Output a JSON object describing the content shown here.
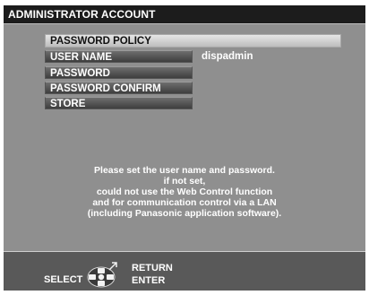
{
  "window": {
    "title": "ADMINISTRATOR ACCOUNT"
  },
  "menu": {
    "items": [
      {
        "label": "PASSWORD POLICY",
        "selected": true
      },
      {
        "label": "USER NAME",
        "value": "dispadmin"
      },
      {
        "label": "PASSWORD"
      },
      {
        "label": "PASSWORD CONFIRM"
      },
      {
        "label": "STORE"
      }
    ]
  },
  "message": {
    "lines": [
      "Please set the user name and password.",
      "if not set,",
      "could not use the Web Control function",
      "and for communication control via a LAN",
      "(including Panasonic application software)."
    ]
  },
  "footer": {
    "select_label": "SELECT",
    "return_label": "RETURN",
    "enter_label": "ENTER",
    "icon": "dpad-icon"
  }
}
